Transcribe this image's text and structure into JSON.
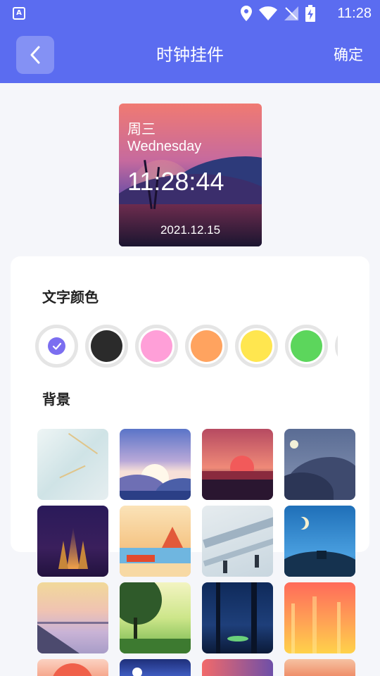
{
  "status_bar": {
    "time": "11:28",
    "app_icon": "A"
  },
  "header": {
    "back_icon": "chevron-left-icon",
    "title": "时钟挂件",
    "confirm_label": "确定"
  },
  "preview": {
    "weekday_cn": "周三",
    "weekday_en": "Wednesday",
    "time": "11:28:44",
    "date": "2021.12.15"
  },
  "text_color": {
    "title": "文字颜色",
    "swatches": [
      {
        "name": "white",
        "color": "#ffffff",
        "selected": true
      },
      {
        "name": "black",
        "color": "#2b2b2b",
        "selected": false
      },
      {
        "name": "pink",
        "color": "#ff9fd8",
        "selected": false
      },
      {
        "name": "orange",
        "color": "#ffa35f",
        "selected": false
      },
      {
        "name": "yellow",
        "color": "#ffe64f",
        "selected": false
      },
      {
        "name": "green",
        "color": "#5cd65c",
        "selected": false
      }
    ]
  },
  "background": {
    "title": "背景",
    "tiles": [
      "marble",
      "sunrise-valley",
      "red-sunset-road",
      "moon-hill",
      "purple-fire",
      "orange-cabin",
      "snowy-slope",
      "blue-moon-house",
      "pastel-lake",
      "green-tree",
      "dark-forest",
      "orange-glow",
      "peach-sun",
      "night-sky",
      "purple-dusk",
      "desert-dunes"
    ]
  },
  "colors": {
    "accent": "#5b6cf0",
    "check": "#7b6ef0"
  }
}
